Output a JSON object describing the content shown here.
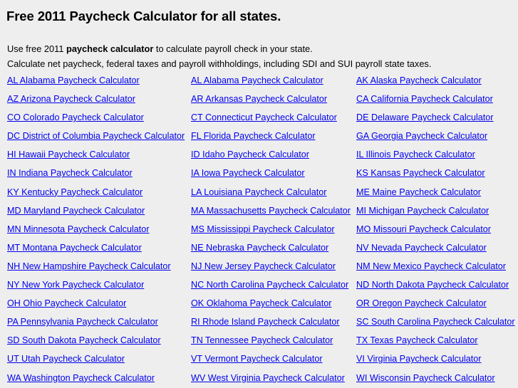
{
  "page": {
    "title": "Free 2011 Paycheck Calculator for all states.",
    "background_color": "#eeeeee",
    "link_color": "#0000ee",
    "text_color": "#000000"
  },
  "intro": {
    "line1_part1": "Use free 2011 ",
    "line1_bold": "paycheck calculator",
    "line1_part2": " to calculate payroll check in your state.",
    "line2": "Calculate net paycheck, federal taxes and payroll withholdings, including SDI and SUI payroll state taxes."
  },
  "links": {
    "columns": [
      {
        "items": [
          "AL Alabama Paycheck Calculator",
          "AZ Arizona Paycheck Calculator",
          "CO Colorado Paycheck Calculator",
          "DC District of Columbia Paycheck Calculator",
          "HI Hawaii Paycheck Calculator",
          "IN Indiana Paycheck Calculator",
          "KY Kentucky Paycheck Calculator",
          "MD Maryland Paycheck Calculator",
          "MN Minnesota Paycheck Calculator",
          "MT Montana Paycheck Calculator",
          "NH New Hampshire Paycheck Calculator",
          "NY New York Paycheck Calculator",
          "OH Ohio Paycheck Calculator",
          "PA Pennsylvania Paycheck Calculator",
          "SD South Dakota Paycheck Calculator",
          "UT Utah Paycheck Calculator",
          "WA Washington Paycheck Calculator"
        ]
      },
      {
        "items": [
          "AL Alabama Paycheck Calculator",
          "AR Arkansas Paycheck Calculator",
          "CT Connecticut Paycheck Calculator",
          "FL Florida Paycheck Calculator",
          "ID Idaho Paycheck Calculator",
          "IA Iowa Paycheck Calculator",
          "LA Louisiana Paycheck Calculator",
          "MA Massachusetts Paycheck Calculator",
          "MS Mississippi Paycheck Calculator",
          "NE Nebraska Paycheck Calculator",
          "NJ New Jersey Paycheck Calculator",
          "NC North Carolina Paycheck Calculator",
          "OK Oklahoma Paycheck Calculator",
          "RI Rhode Island Paycheck Calculator",
          "TN Tennessee Paycheck Calculator",
          "VT Vermont Paycheck Calculator",
          "WV West Virginia Paycheck Calculator"
        ]
      },
      {
        "items": [
          "AK Alaska Paycheck Calculator",
          "CA California Paycheck Calculator",
          "DE Delaware Paycheck Calculator",
          "GA Georgia Paycheck Calculator",
          "IL Illinois Paycheck Calculator",
          "KS Kansas Paycheck Calculator",
          "ME Maine Paycheck Calculator",
          "MI Michigan Paycheck Calculator",
          "MO Missouri Paycheck Calculator",
          "NV Nevada Paycheck Calculator",
          "NM New Mexico Paycheck Calculator",
          "ND North Dakota Paycheck Calculator",
          "OR Oregon Paycheck Calculator",
          "SC South Carolina Paycheck Calculator",
          "TX Texas Paycheck Calculator",
          "VI Virginia Paycheck Calculator",
          "WI Wisconsin Paycheck Calculator"
        ]
      }
    ]
  }
}
